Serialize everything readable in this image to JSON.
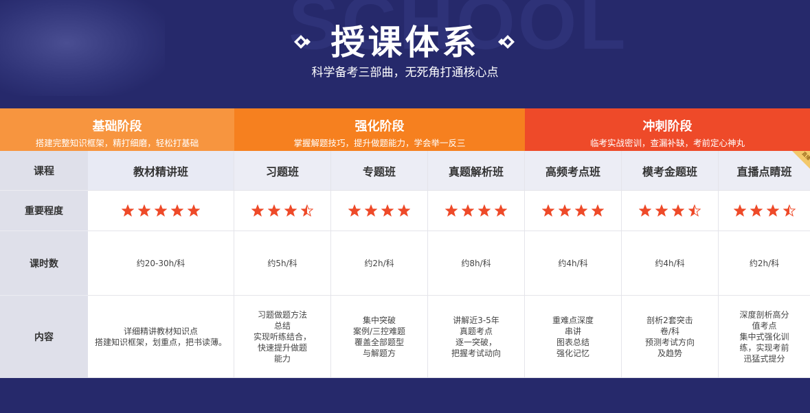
{
  "header": {
    "title": "授课体系",
    "subtitle": "科学备考三部曲，无死角打通核心点",
    "bg_word": "SCHOOL"
  },
  "stages": [
    {
      "name": "基础阶段",
      "desc": "搭建完整知识框架，精打细磨，轻松打基础",
      "color": "#f7953f"
    },
    {
      "name": "强化阶段",
      "desc": "掌握解题技巧，提升做题能力，学会举一反三",
      "color": "#f6801f"
    },
    {
      "name": "冲刺阶段",
      "desc": "临考实战密训，查漏补缺，考前定心神丸",
      "color": "#ee4a29"
    }
  ],
  "row_labels": {
    "course": "课程",
    "importance": "重要程度",
    "hours": "课时数",
    "content": "内容"
  },
  "courses": [
    {
      "name": "教材精讲班",
      "stars": 5,
      "hours": "约20-30h/科",
      "content": [
        "详细精讲教材知识点",
        "搭建知识框架，划重点，把书读薄。"
      ]
    },
    {
      "name": "习题班",
      "stars": 3.5,
      "hours": "约5h/科",
      "content": [
        "习题做题方法",
        "总结",
        "实现听练结合，",
        "快速提升做题",
        "能力"
      ]
    },
    {
      "name": "专题班",
      "stars": 4,
      "hours": "约2h/科",
      "content": [
        "集中突破",
        "案例/三控难题",
        "覆盖全部题型",
        "与解题方"
      ]
    },
    {
      "name": "真题解析班",
      "stars": 4,
      "hours": "约8h/科",
      "content": [
        "讲解近3-5年",
        "真题考点",
        "逐一突破，",
        "把握考试动向"
      ]
    },
    {
      "name": "高频考点班",
      "stars": 4,
      "hours": "约4h/科",
      "content": [
        "重难点深度",
        "串讲",
        "图表总结",
        "强化记忆"
      ]
    },
    {
      "name": "模考金题班",
      "stars": 3.5,
      "hours": "约4h/科",
      "content": [
        "剖析2套突击",
        "卷/科",
        "预测考试方向",
        "及趋势"
      ]
    },
    {
      "name": "直播点睛班",
      "stars": 3.5,
      "hours": "约2h/科",
      "content": [
        "深度剖析高分",
        "值考点",
        "集中式强化训",
        "练，实现考前",
        "迅猛式提分"
      ]
    }
  ],
  "corner_tag": "直播",
  "colors": {
    "star": "#ee4a29",
    "navy": "#26296b"
  }
}
